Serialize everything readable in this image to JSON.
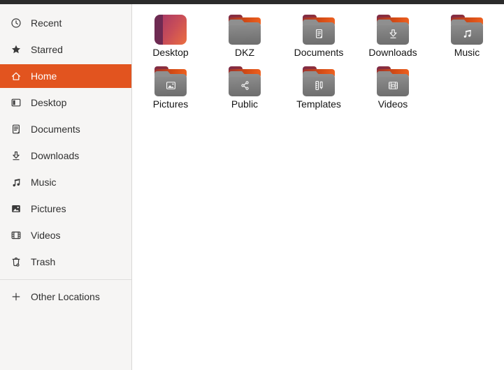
{
  "window": {
    "topbar_color": "#2b2b2b"
  },
  "sidebar": {
    "selected_color": "#e2541f",
    "items": [
      {
        "label": "Recent",
        "icon": "recent-icon",
        "selected": false
      },
      {
        "label": "Starred",
        "icon": "starred-icon",
        "selected": false
      },
      {
        "label": "Home",
        "icon": "home-icon",
        "selected": true
      },
      {
        "label": "Desktop",
        "icon": "desktop-icon",
        "selected": false
      },
      {
        "label": "Documents",
        "icon": "documents-icon",
        "selected": false
      },
      {
        "label": "Downloads",
        "icon": "downloads-icon",
        "selected": false
      },
      {
        "label": "Music",
        "icon": "music-icon",
        "selected": false
      },
      {
        "label": "Pictures",
        "icon": "pictures-icon",
        "selected": false
      },
      {
        "label": "Videos",
        "icon": "videos-icon",
        "selected": false
      },
      {
        "label": "Trash",
        "icon": "trash-icon",
        "selected": false
      },
      {
        "label": "Other Locations",
        "icon": "plus-icon",
        "selected": false,
        "separator_before": true
      }
    ]
  },
  "files": {
    "items": [
      {
        "label": "Desktop",
        "icon": "desktop-art-icon"
      },
      {
        "label": "DKZ",
        "icon": "folder-plain-icon"
      },
      {
        "label": "Documents",
        "icon": "folder-documents-icon"
      },
      {
        "label": "Downloads",
        "icon": "folder-downloads-icon"
      },
      {
        "label": "Music",
        "icon": "folder-music-icon"
      },
      {
        "label": "Pictures",
        "icon": "folder-pictures-icon"
      },
      {
        "label": "Public",
        "icon": "folder-public-icon"
      },
      {
        "label": "Templates",
        "icon": "folder-templates-icon"
      },
      {
        "label": "Videos",
        "icon": "folder-videos-icon"
      }
    ]
  },
  "colors": {
    "sidebar_bg": "#f6f5f4",
    "selection_orange": "#e2541f",
    "folder_grey_top": "#909090",
    "folder_grey_bottom": "#6d6d6d",
    "folder_back_orange": "#ee6120",
    "folder_tab_maroon": "#7e2c47"
  }
}
